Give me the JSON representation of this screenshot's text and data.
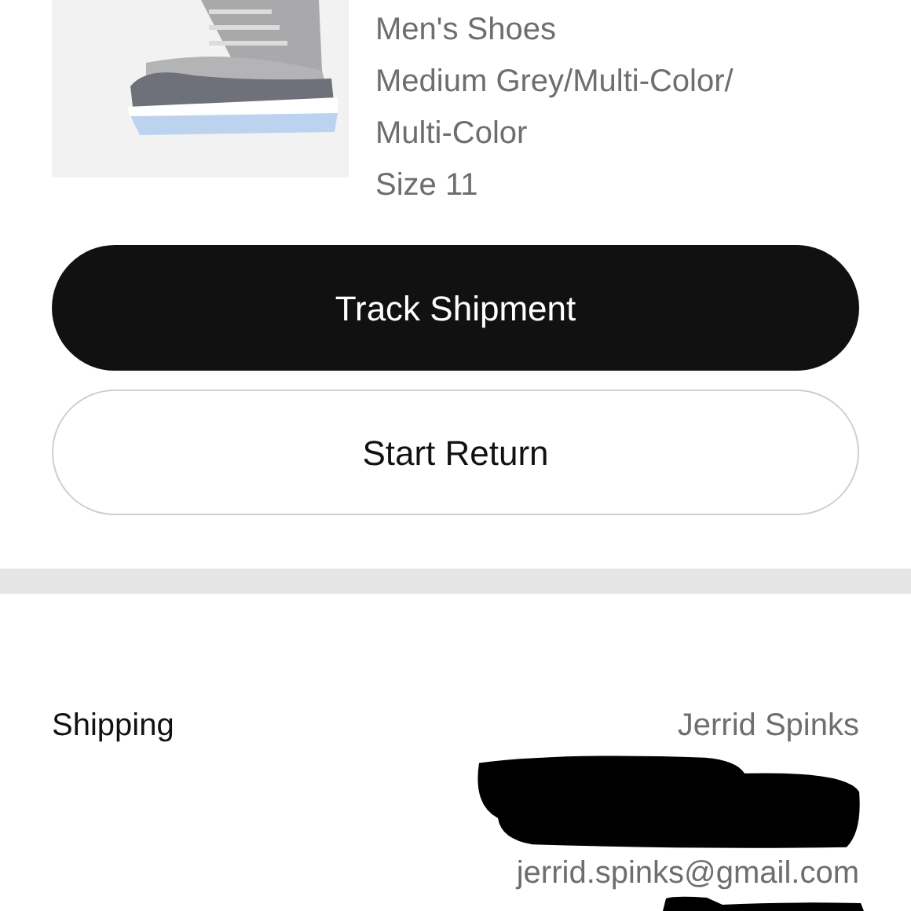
{
  "product": {
    "details": [
      "Men's Shoes",
      "Medium Grey/Multi-Color/",
      "Multi-Color",
      "Size 11"
    ]
  },
  "buttons": [
    {
      "label": "Track Shipment",
      "kind": "primary"
    },
    {
      "label": "Start Return",
      "kind": "outline"
    }
  ],
  "shipping": {
    "label": "Shipping",
    "name": "Jerrid Spinks",
    "email": "jerrid.spinks@gmail.com"
  }
}
